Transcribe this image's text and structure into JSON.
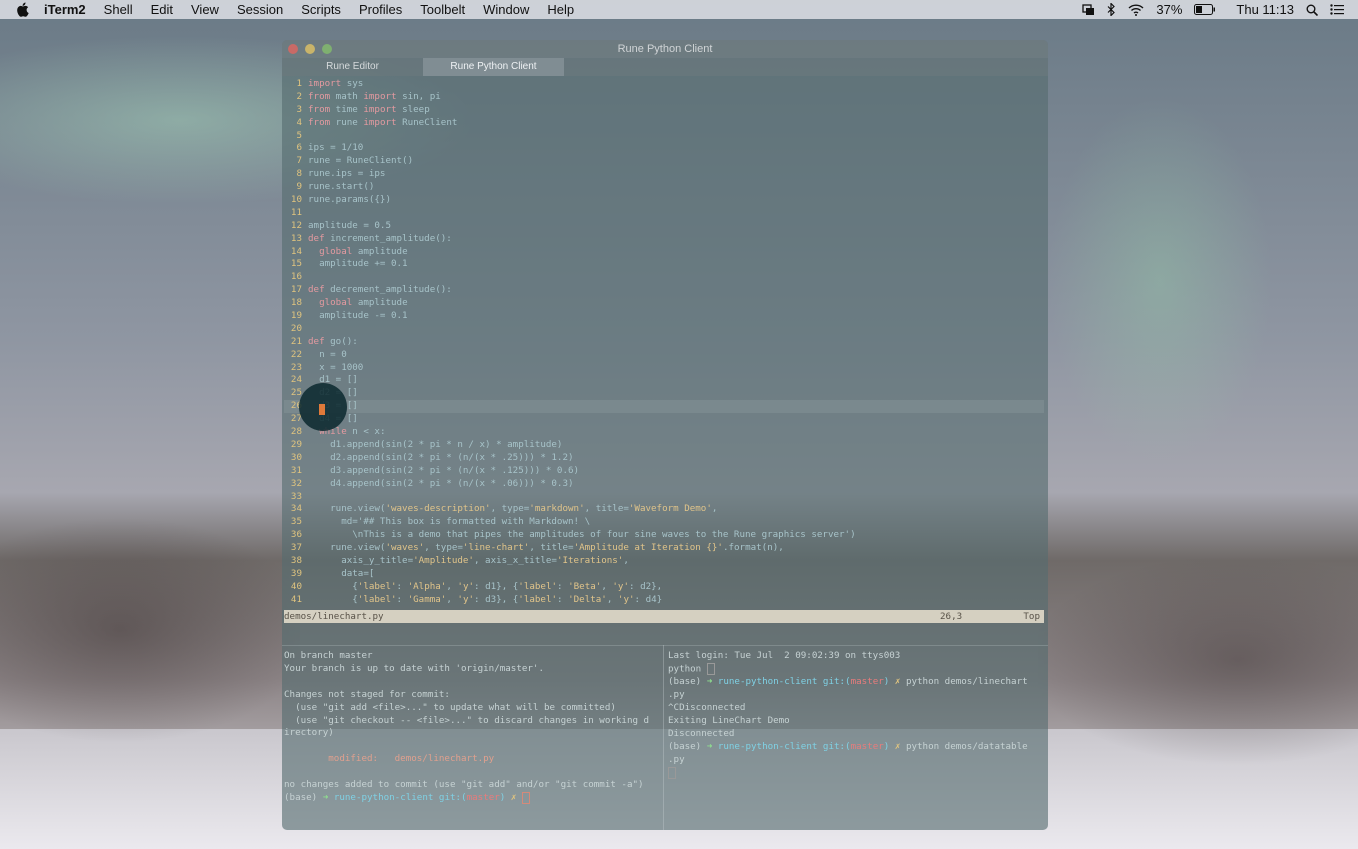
{
  "menubar": {
    "app": "iTerm2",
    "items": [
      "Shell",
      "Edit",
      "View",
      "Session",
      "Scripts",
      "Profiles",
      "Toolbelt",
      "Window",
      "Help"
    ],
    "battery": "37%",
    "clock": "Thu 11:13"
  },
  "window": {
    "title": "Rune Python Client",
    "tabs": [
      "Rune Editor",
      "Rune Python Client"
    ],
    "active_tab": 1
  },
  "editor": {
    "lines": [
      {
        "n": "1",
        "t": "import sys"
      },
      {
        "n": "2",
        "t": "from math import sin, pi"
      },
      {
        "n": "3",
        "t": "from time import sleep"
      },
      {
        "n": "4",
        "t": "from rune import RuneClient"
      },
      {
        "n": "5",
        "t": ""
      },
      {
        "n": "6",
        "t": "ips = 1/10"
      },
      {
        "n": "7",
        "t": "rune = RuneClient()"
      },
      {
        "n": "8",
        "t": "rune.ips = ips"
      },
      {
        "n": "9",
        "t": "rune.start()"
      },
      {
        "n": "10",
        "t": "rune.params({})"
      },
      {
        "n": "11",
        "t": ""
      },
      {
        "n": "12",
        "t": "amplitude = 0.5"
      },
      {
        "n": "13",
        "t": "def increment_amplitude():"
      },
      {
        "n": "14",
        "t": "  global amplitude"
      },
      {
        "n": "15",
        "t": "  amplitude += 0.1"
      },
      {
        "n": "16",
        "t": ""
      },
      {
        "n": "17",
        "t": "def decrement_amplitude():"
      },
      {
        "n": "18",
        "t": "  global amplitude"
      },
      {
        "n": "19",
        "t": "  amplitude -= 0.1"
      },
      {
        "n": "20",
        "t": ""
      },
      {
        "n": "21",
        "t": "def go():"
      },
      {
        "n": "22",
        "t": "  n = 0"
      },
      {
        "n": "23",
        "t": "  x = 1000"
      },
      {
        "n": "24",
        "t": "  d1 = []"
      },
      {
        "n": "25",
        "t": "  d2 = []"
      },
      {
        "n": "26",
        "t": "  d3 = []"
      },
      {
        "n": "27",
        "t": "  d4 = []"
      },
      {
        "n": "28",
        "t": "  while n < x:"
      },
      {
        "n": "29",
        "t": "    d1.append(sin(2 * pi * n / x) * amplitude)"
      },
      {
        "n": "30",
        "t": "    d2.append(sin(2 * pi * (n/(x * .25))) * 1.2)"
      },
      {
        "n": "31",
        "t": "    d3.append(sin(2 * pi * (n/(x * .125))) * 0.6)"
      },
      {
        "n": "32",
        "t": "    d4.append(sin(2 * pi * (n/(x * .06))) * 0.3)"
      },
      {
        "n": "33",
        "t": ""
      },
      {
        "n": "34",
        "t": "    rune.view('waves-description', type='markdown', title='Waveform Demo',"
      },
      {
        "n": "35",
        "t": "      md='## This box is formatted with Markdown! \\"
      },
      {
        "n": "36",
        "t": "        \\nThis is a demo that pipes the amplitudes of four sine waves to the Rune graphics server')"
      },
      {
        "n": "37",
        "t": "    rune.view('waves', type='line-chart', title='Amplitude at Iteration {}'.format(n),"
      },
      {
        "n": "38",
        "t": "      axis_y_title='Amplitude', axis_x_title='Iterations',"
      },
      {
        "n": "39",
        "t": "      data=["
      },
      {
        "n": "40",
        "t": "        {'label': 'Alpha', 'y': d1}, {'label': 'Beta', 'y': d2},"
      },
      {
        "n": "41",
        "t": "        {'label': 'Gamma', 'y': d3}, {'label': 'Delta', 'y': d4}"
      }
    ],
    "current_line": "26",
    "status_file": "demos/linechart.py",
    "status_pos": "26,3",
    "status_scroll": "Top"
  },
  "left_pane": {
    "l1": "On branch master",
    "l2": "Your branch is up to date with 'origin/master'.",
    "l3": "",
    "l4": "Changes not staged for commit:",
    "l5": "  (use \"git add <file>...\" to update what will be committed)",
    "l6": "  (use \"git checkout -- <file>...\" to discard changes in working d",
    "l7": "irectory)",
    "l8": "",
    "mod_label": "        modified:   demos/linechart.py",
    "l10": "",
    "l11": "no changes added to commit (use \"git add\" and/or \"git commit -a\")",
    "prompt_base": "(base) ",
    "prompt_arrow": "➜ ",
    "prompt_dir": "rune-python-client ",
    "prompt_git": "git:(",
    "prompt_branch": "master",
    "prompt_git_close": ") ",
    "prompt_x": "✗ "
  },
  "right_pane": {
    "l1": "Last login: Tue Jul  2 09:02:39 on ttys003",
    "l2": "python ",
    "cmd1": "python demos/linechart",
    "cmd1b": ".py",
    "l4": "^CDisconnected",
    "l5": "Exiting LineChart Demo",
    "l6": "Disconnected",
    "cmd2": "python demos/datatable",
    "cmd2b": ".py"
  }
}
